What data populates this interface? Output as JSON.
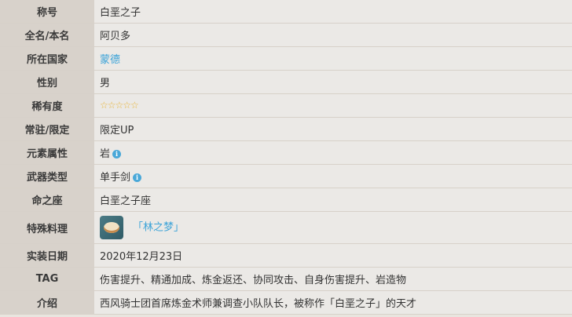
{
  "rows": [
    {
      "label": "称号",
      "value": "白垩之子"
    },
    {
      "label": "全名/本名",
      "value": "阿贝多"
    },
    {
      "label": "所在国家",
      "value": "蒙德"
    },
    {
      "label": "性别",
      "value": "男"
    },
    {
      "label": "稀有度",
      "value": "☆☆☆☆☆"
    },
    {
      "label": "常驻/限定",
      "value": "限定UP"
    },
    {
      "label": "元素属性",
      "value": "岩"
    },
    {
      "label": "武器类型",
      "value": "单手剑"
    },
    {
      "label": "命之座",
      "value": "白垩之子座"
    },
    {
      "label": "特殊料理",
      "value": "「林之梦」"
    },
    {
      "label": "实装日期",
      "value": "2020年12月23日"
    },
    {
      "label": "TAG",
      "value": "伤害提升、精通加成、炼金返还、协同攻击、自身伤害提升、岩造物"
    },
    {
      "label": "介绍",
      "value": "西风骑士团首席炼金术师兼调查小队队长，被称作「白垩之子」的天才"
    }
  ],
  "icons": {
    "info": "info-icon",
    "dish": "dish-icon"
  },
  "colors": {
    "label_bg": "#d8d2cb",
    "value_bg": "#ebe9e6",
    "link": "#3ba3d8",
    "star": "#e7b53a"
  }
}
